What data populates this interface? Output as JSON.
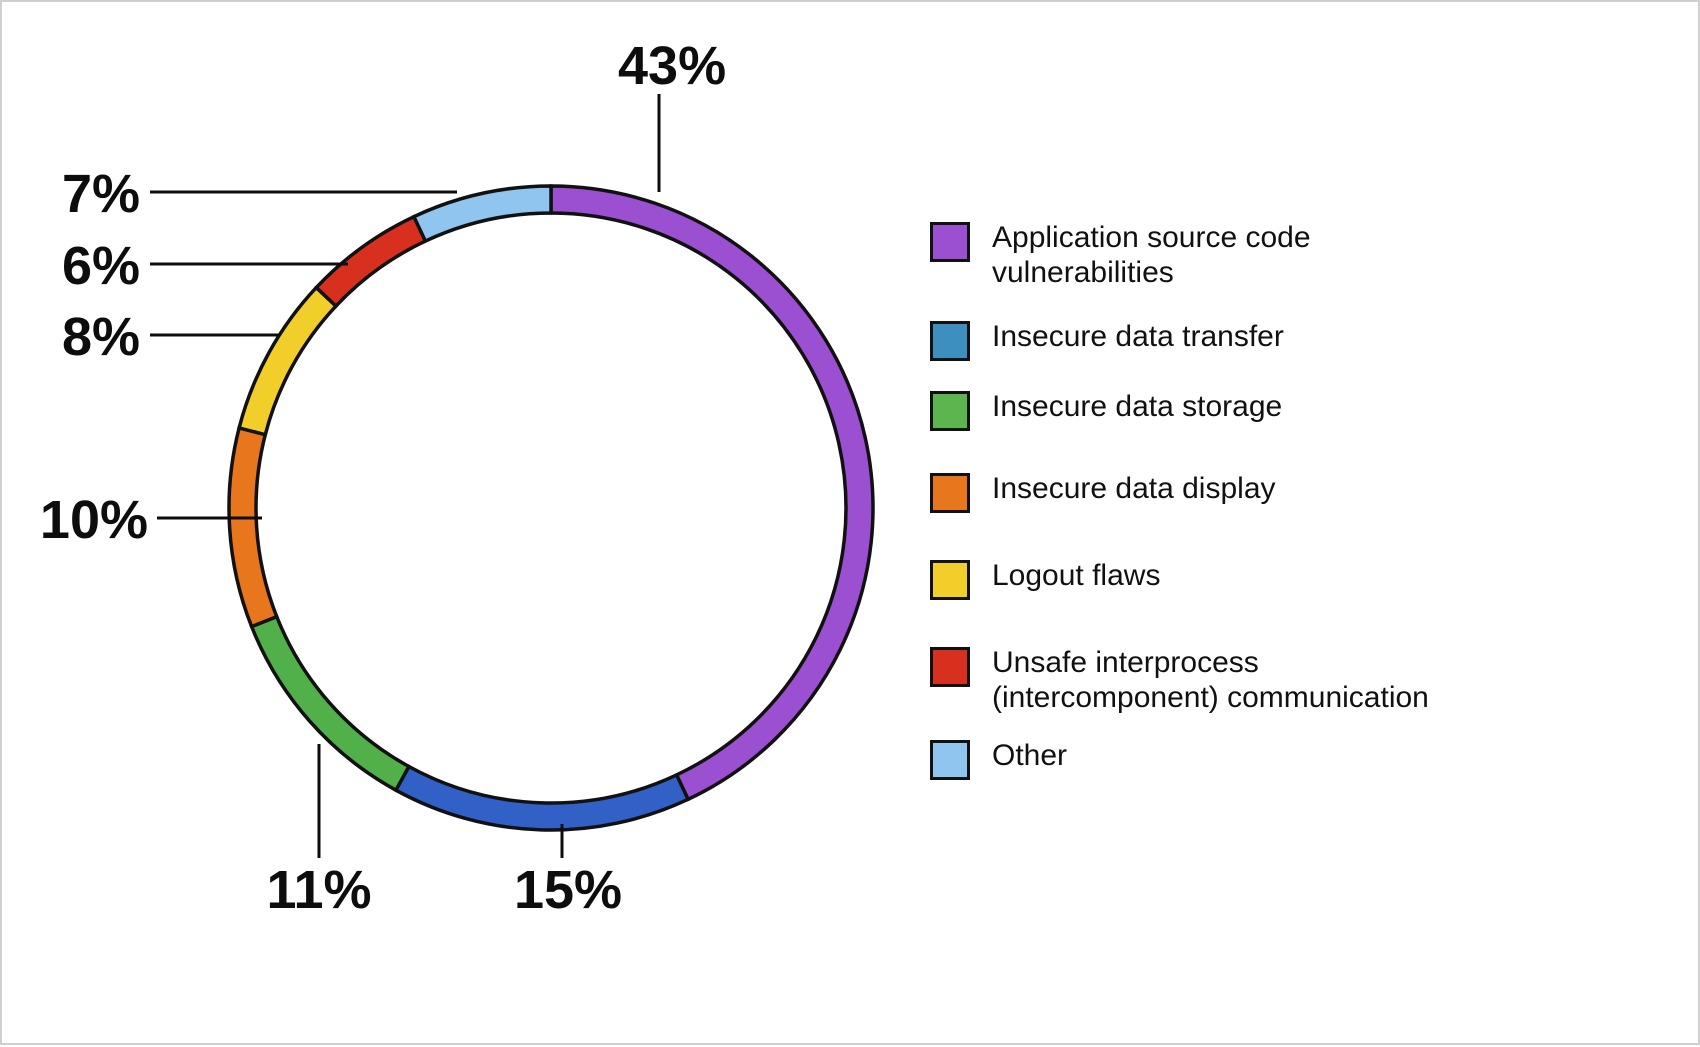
{
  "chart_data": {
    "type": "pie",
    "variant": "donut",
    "title": "",
    "subtitle": "",
    "xlabel": "",
    "ylabel": "",
    "legend_position": "right",
    "grid": false,
    "value_suffix": "%",
    "start_angle_deg": 0,
    "direction": "clockwise",
    "categories": [
      "Application source code vulnerabilities",
      "Insecure data transfer",
      "Insecure data storage",
      "Insecure data display",
      "Logout flaws",
      "Unsafe interprocess (intercomponent) communication",
      "Other"
    ],
    "values": [
      43,
      15,
      11,
      10,
      8,
      6,
      7
    ],
    "labels": [
      "43%",
      "15%",
      "11%",
      "10%",
      "8%",
      "6%",
      "7%"
    ],
    "colors": [
      "#9B4FD1",
      "#3160C6",
      "#52B04B",
      "#E8761C",
      "#F2CE2B",
      "#D7301F",
      "#8FC5EF"
    ]
  },
  "slices": [
    {
      "id": "application-source-code-vulnerabilities",
      "label": "43%",
      "value": 43,
      "color": "#9B4FD1"
    },
    {
      "id": "insecure-data-transfer",
      "label": "15%",
      "value": 15,
      "color": "#3160C6"
    },
    {
      "id": "insecure-data-storage",
      "label": "11%",
      "value": 11,
      "color": "#52B04B"
    },
    {
      "id": "insecure-data-display",
      "label": "10%",
      "value": 10,
      "color": "#E8761C"
    },
    {
      "id": "logout-flaws",
      "label": "8%",
      "value": 8,
      "color": "#F2CE2B"
    },
    {
      "id": "unsafe-interprocess-communication",
      "label": "6%",
      "value": 6,
      "color": "#D7301F"
    },
    {
      "id": "other",
      "label": "7%",
      "value": 7,
      "color": "#8FC5EF"
    }
  ],
  "legend": {
    "items": [
      {
        "label": "Application source code vulnerabilities",
        "color": "#9B4FD1"
      },
      {
        "label": "Insecure data transfer",
        "color": "#3D8FBF"
      },
      {
        "label": "Insecure data storage",
        "color": "#5CB54F"
      },
      {
        "label": "Insecure data display",
        "color": "#E8761C"
      },
      {
        "label": "Logout flaws",
        "color": "#F2CE2B"
      },
      {
        "label": "Unsafe interprocess (intercomponent) communication",
        "color": "#D7301F"
      },
      {
        "label": "Other",
        "color": "#8FC5EF"
      }
    ]
  },
  "callouts": {
    "pct_43": "43%",
    "pct_15": "15%",
    "pct_11": "11%",
    "pct_10": "10%",
    "pct_8": "8%",
    "pct_6": "6%",
    "pct_7": "7%"
  }
}
